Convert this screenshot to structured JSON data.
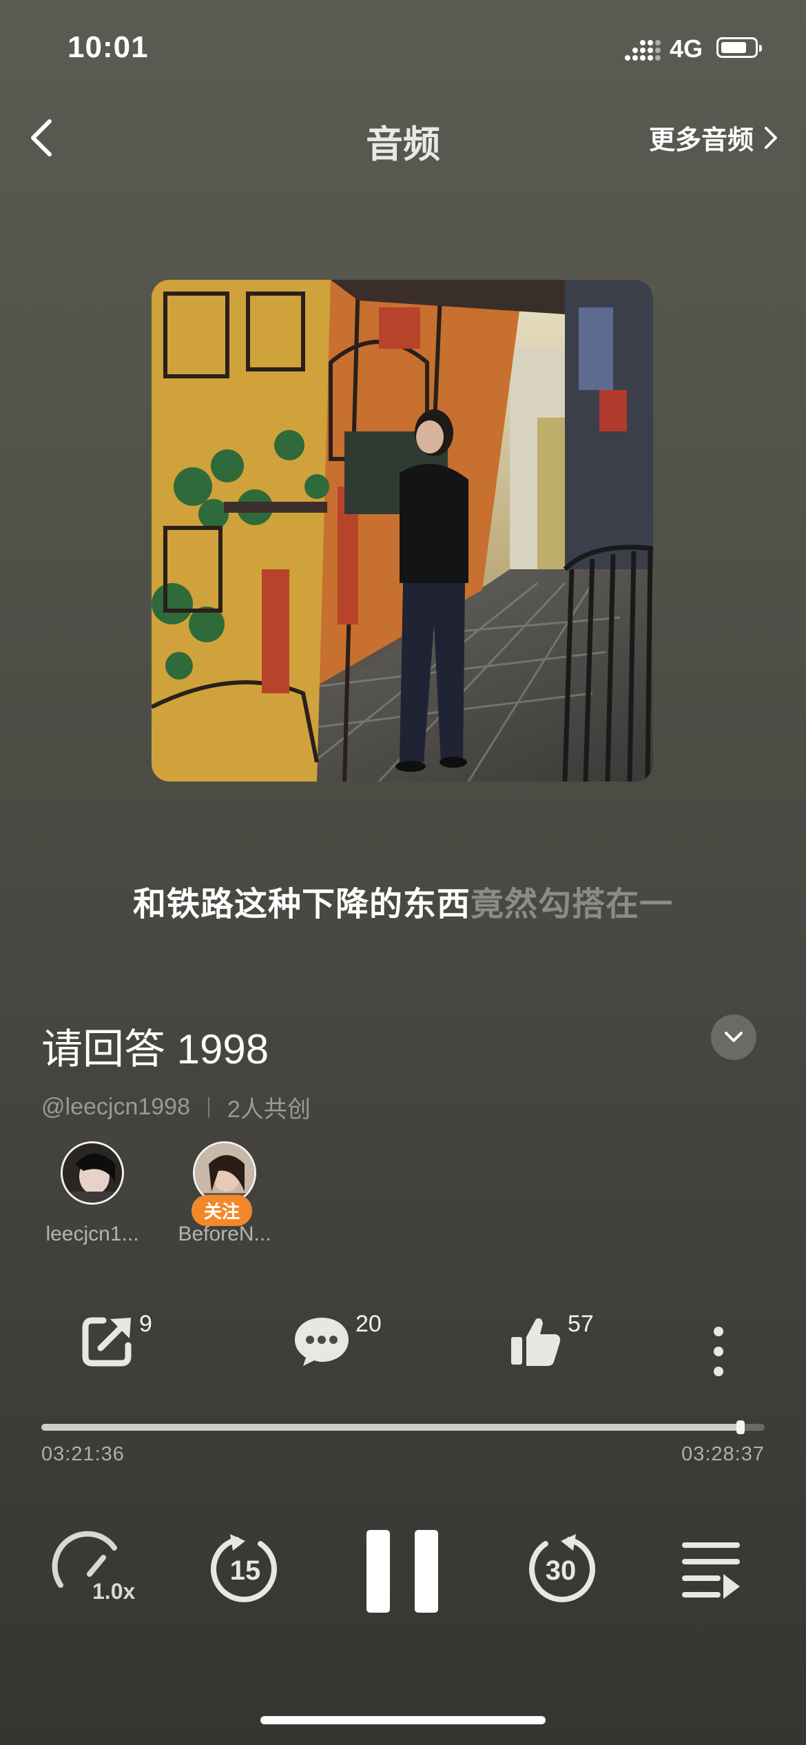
{
  "status_bar": {
    "time": "10:01",
    "network": "4G"
  },
  "nav": {
    "title": "音频",
    "more_label": "更多音频"
  },
  "lyric": {
    "highlighted": "和铁路这种下降的东西",
    "upcoming": "竟然勾搭在一"
  },
  "track": {
    "title": "请回答 1998",
    "author": "@leecjcn1998",
    "co_create": "2人共创"
  },
  "creators": [
    {
      "name": "leecjcn1...",
      "following": true
    },
    {
      "name": "BeforeN...",
      "follow_label": "关注"
    }
  ],
  "actions": {
    "share_count": "9",
    "comment_count": "20",
    "like_count": "57"
  },
  "playback": {
    "current_time": "03:21:36",
    "total_time": "03:28:37",
    "progress": 0.967,
    "speed": "1.0x",
    "rewind_seconds": "15",
    "forward_seconds": "30",
    "state": "playing"
  },
  "colors": {
    "accent_follow": "#f2882b",
    "background": "#4e4d46"
  }
}
